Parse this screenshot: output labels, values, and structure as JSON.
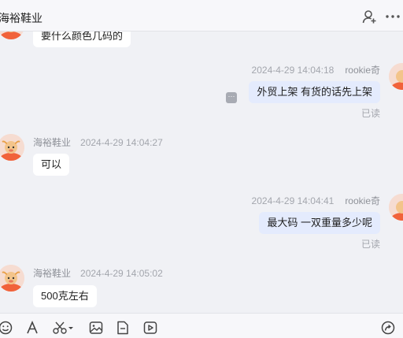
{
  "header": {
    "title": "海裕鞋业",
    "icons": [
      "add-contact-icon",
      "more-icon"
    ]
  },
  "messages": [
    {
      "direction": "in",
      "text": "要什么颜色几码的"
    },
    {
      "direction": "out",
      "time": "2024-4-29 14:04:18",
      "sender": "rookie奇",
      "text": "外贸上架  有货的话先上架",
      "status": "已读"
    },
    {
      "direction": "in",
      "sender": "海裕鞋业",
      "time": "2024-4-29 14:04:27",
      "text": "可以"
    },
    {
      "direction": "out",
      "time": "2024-4-29 14:04:41",
      "sender": "rookie奇",
      "text": "最大码 一双重量多少呢",
      "status": "已读"
    },
    {
      "direction": "in",
      "sender": "海裕鞋业",
      "time": "2024-4-29 14:05:02",
      "text": "500克左右"
    }
  ],
  "toolbar": {
    "icons": [
      "emoji-icon",
      "font-icon",
      "scissors-icon",
      "image-icon",
      "file-icon",
      "video-icon",
      "share-icon"
    ]
  },
  "colors": {
    "background": "#f0f1f5",
    "outgoing_bubble": "#e4ebfd",
    "incoming_bubble": "#ffffff",
    "meta_text": "#a3a6ad"
  }
}
